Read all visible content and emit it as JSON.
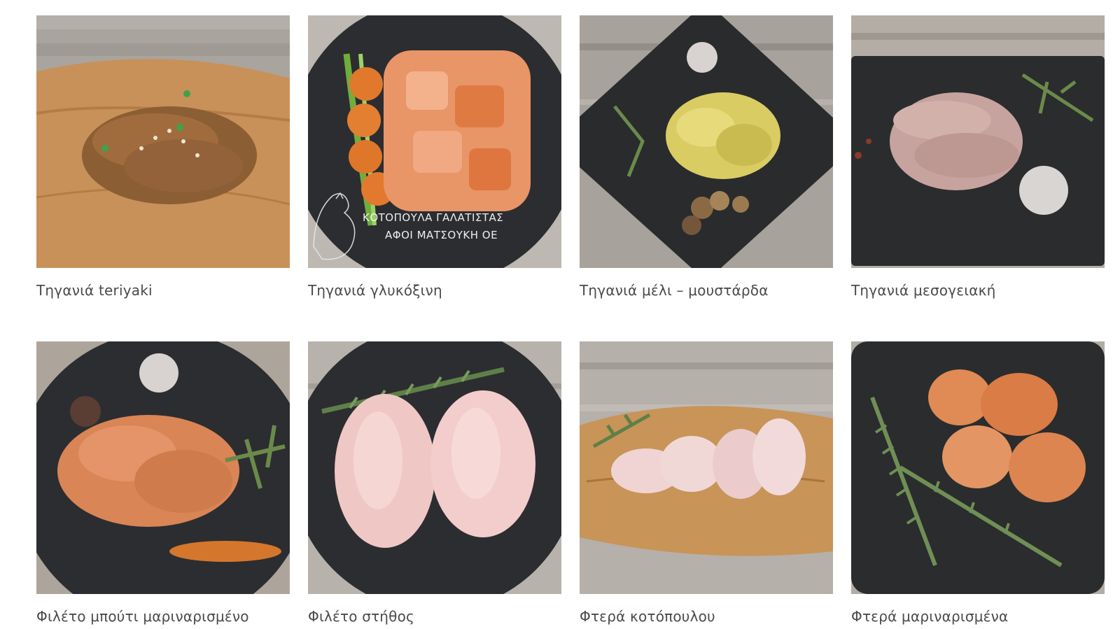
{
  "products": [
    {
      "title": "Τηγανιά teriyaki",
      "image_icon": "teriyaki-strips-photo"
    },
    {
      "title": "Τηγανιά γλυκόξινη",
      "image_icon": "sweet-sour-cubes-photo",
      "watermark": {
        "line1": "ΚΟΤΟΠΟΥΛΑ ΓΑΛΑΤΙΣΤΑΣ",
        "line2": "ΑΦΟΙ ΜΑΤΣΟΥΚΗ ΟΕ"
      }
    },
    {
      "title": "Τηγανιά μέλι – μουστάρδα",
      "image_icon": "honey-mustard-cubes-photo"
    },
    {
      "title": "Τηγανιά μεσογειακή",
      "image_icon": "mediterranean-strips-photo"
    },
    {
      "title": "Φιλέτο μπούτι μαριναρισμένο",
      "image_icon": "marinated-thigh-fillet-photo"
    },
    {
      "title": "Φιλέτο στήθος",
      "image_icon": "breast-fillet-photo"
    },
    {
      "title": "Φτερά κοτόπουλου",
      "image_icon": "chicken-wings-photo"
    },
    {
      "title": "Φτερά μαριναρισμένα",
      "image_icon": "marinated-wings-photo"
    }
  ],
  "colors": {
    "title_text": "#4a4a4a",
    "slate": "#2a2b2d",
    "wood_board": "#c9935a",
    "wood_table": "#b9b3ab"
  }
}
